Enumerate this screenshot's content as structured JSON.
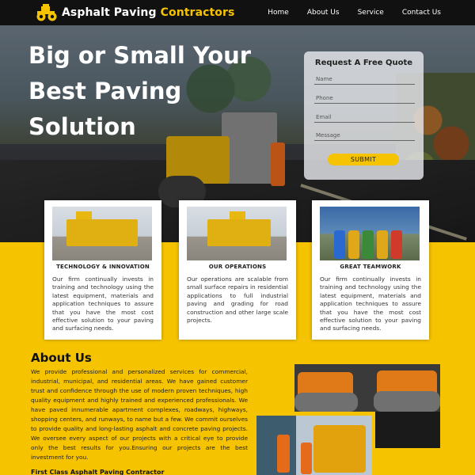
{
  "header": {
    "logo_part1": "Asphalt Paving",
    "logo_part2": "Contractors",
    "nav": [
      "Home",
      "About Us",
      "Service",
      "Contact Us"
    ]
  },
  "hero": {
    "title": "Big or Small Your Best Paving Solution"
  },
  "quote_form": {
    "title": "Request A Free Quote",
    "name_placeholder": "Name",
    "phone_placeholder": "Phone",
    "email_placeholder": "Email",
    "message_placeholder": "Message",
    "submit_label": "SUBMIT"
  },
  "cards": [
    {
      "title": "TECHNOLOGY & INNOVATION",
      "text": "Our firm continually invests in training and technology using the latest equipment, materials and application techniques to assure that you have the most cost effective solution to your paving and surfacing needs."
    },
    {
      "title": "OUR OPERATIONS",
      "text": "Our operations are scalable from small surface repairs in residential applications to full industrial paving and grading for road construction and other large scale projects."
    },
    {
      "title": "GREAT TEAMWORK",
      "text": "Our firm continually invests in training and technology using the latest equipment, materials and application techniques to assure that you have the most cost effective solution to your paving and surfacing needs."
    }
  ],
  "about": {
    "title": "About Us",
    "text": "We provide professional and personalized services for commercial, industrial, municipal, and residential areas. We have gained customer trust and confidence through the use of modern proven techniques, high quality equipment and highly trained and experienced professionals. We have paved innumerable apartment complexes, roadways, highways, shopping centers, and runways, to name but a few. We commit ourselves to provide quality and long-lasting asphalt and concrete paving projects. We oversee every aspect of our projects with a critical eye to provide only the best results for you.Ensuring our projects are the best investment for you.",
    "subheading": "First Class Asphalt Paving Contractor"
  },
  "colors": {
    "accent": "#f5c300",
    "header_bg": "#111111"
  }
}
